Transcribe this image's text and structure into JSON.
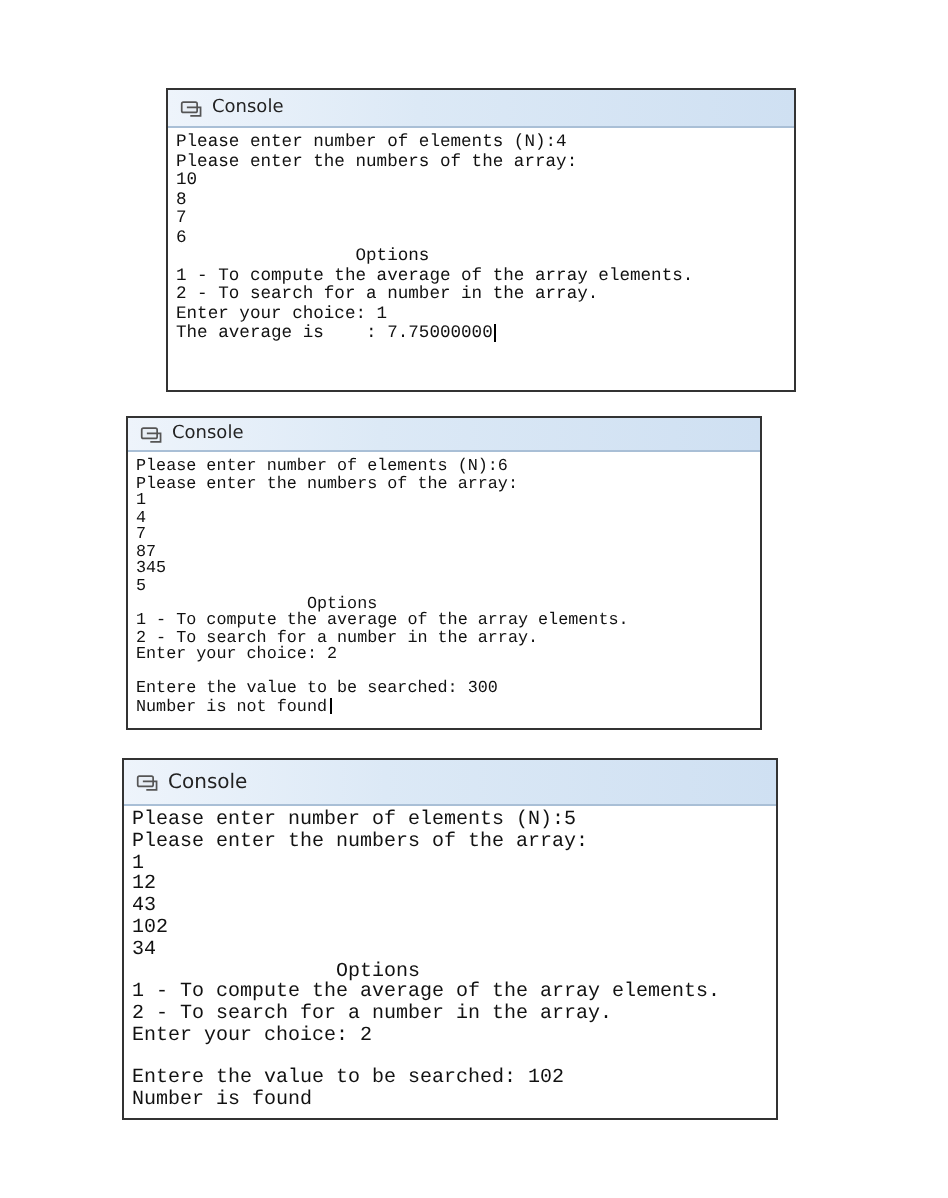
{
  "consoles": [
    {
      "title": "Console",
      "cursor": true,
      "blocks": [
        [
          {
            "kind": "line",
            "text": "Please enter number of elements (N):4"
          },
          {
            "kind": "line",
            "text": "Please enter the numbers of the array:"
          },
          {
            "kind": "line",
            "text": "10"
          },
          {
            "kind": "line",
            "text": "8"
          },
          {
            "kind": "line",
            "text": "7"
          },
          {
            "kind": "line",
            "text": "6"
          },
          {
            "kind": "heading",
            "text": "Options"
          },
          {
            "kind": "line",
            "text": "1 - To compute the average of the array elements."
          },
          {
            "kind": "line",
            "text": "2 - To search for a number in the array."
          },
          {
            "kind": "line",
            "text": "Enter your choice: 1"
          },
          {
            "kind": "line",
            "text": "The average is    : 7.75000000"
          }
        ]
      ]
    },
    {
      "title": "Console",
      "cursor": true,
      "blocks": [
        [
          {
            "kind": "line",
            "text": "Please enter number of elements (N):6"
          },
          {
            "kind": "line",
            "text": "Please enter the numbers of the array:"
          },
          {
            "kind": "line",
            "text": "1"
          },
          {
            "kind": "line",
            "text": "4"
          },
          {
            "kind": "line",
            "text": "7"
          },
          {
            "kind": "line",
            "text": "87"
          },
          {
            "kind": "line",
            "text": "345"
          },
          {
            "kind": "line",
            "text": "5"
          },
          {
            "kind": "heading",
            "text": "Options"
          },
          {
            "kind": "line",
            "text": "1 - To compute the average of the array elements."
          },
          {
            "kind": "line",
            "text": "2 - To search for a number in the array."
          },
          {
            "kind": "line",
            "text": "Enter your choice: 2"
          }
        ],
        [
          {
            "kind": "line",
            "text": "Entere the value to be searched: 300"
          },
          {
            "kind": "line",
            "text": "Number is not found"
          }
        ]
      ]
    },
    {
      "title": "Console",
      "cursor": false,
      "blocks": [
        [
          {
            "kind": "line",
            "text": "Please enter number of elements (N):5"
          },
          {
            "kind": "line",
            "text": "Please enter the numbers of the array:"
          },
          {
            "kind": "line",
            "text": "1"
          },
          {
            "kind": "line",
            "text": "12"
          },
          {
            "kind": "line",
            "text": "43"
          },
          {
            "kind": "line",
            "text": "102"
          },
          {
            "kind": "line",
            "text": "34"
          },
          {
            "kind": "heading",
            "text": "Options"
          },
          {
            "kind": "line",
            "text": "1 - To compute the average of the array elements."
          },
          {
            "kind": "line",
            "text": "2 - To search for a number in the array."
          },
          {
            "kind": "line",
            "text": "Enter your choice: 2"
          }
        ],
        [
          {
            "kind": "line",
            "text": "Entere the value to be searched: 102"
          },
          {
            "kind": "line",
            "text": "Number is found"
          }
        ]
      ]
    }
  ]
}
